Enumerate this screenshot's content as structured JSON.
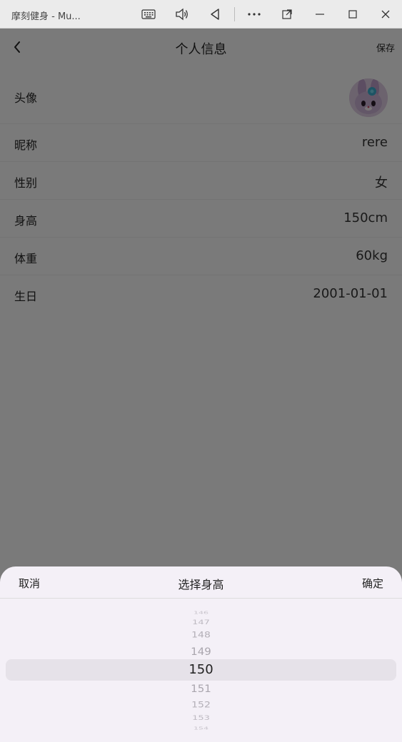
{
  "window": {
    "title": "摩刻健身 - Mu..."
  },
  "header": {
    "title": "个人信息",
    "save_label": "保存"
  },
  "profile": {
    "avatar_label": "头像",
    "rows": [
      {
        "label": "昵称",
        "value": "rere"
      },
      {
        "label": "性别",
        "value": "女"
      },
      {
        "label": "身高",
        "value": "150cm"
      },
      {
        "label": "体重",
        "value": "60kg"
      },
      {
        "label": "生日",
        "value": "2001-01-01"
      }
    ]
  },
  "picker": {
    "cancel_label": "取消",
    "title": "选择身高",
    "confirm_label": "确定",
    "selected": "150",
    "options": [
      "146",
      "147",
      "148",
      "149",
      "150",
      "151",
      "152",
      "153",
      "154"
    ]
  },
  "colors": {
    "overlay": "#777777",
    "sheet_bg": "#f4f0f7",
    "selection_band": "#e6e2e9"
  }
}
